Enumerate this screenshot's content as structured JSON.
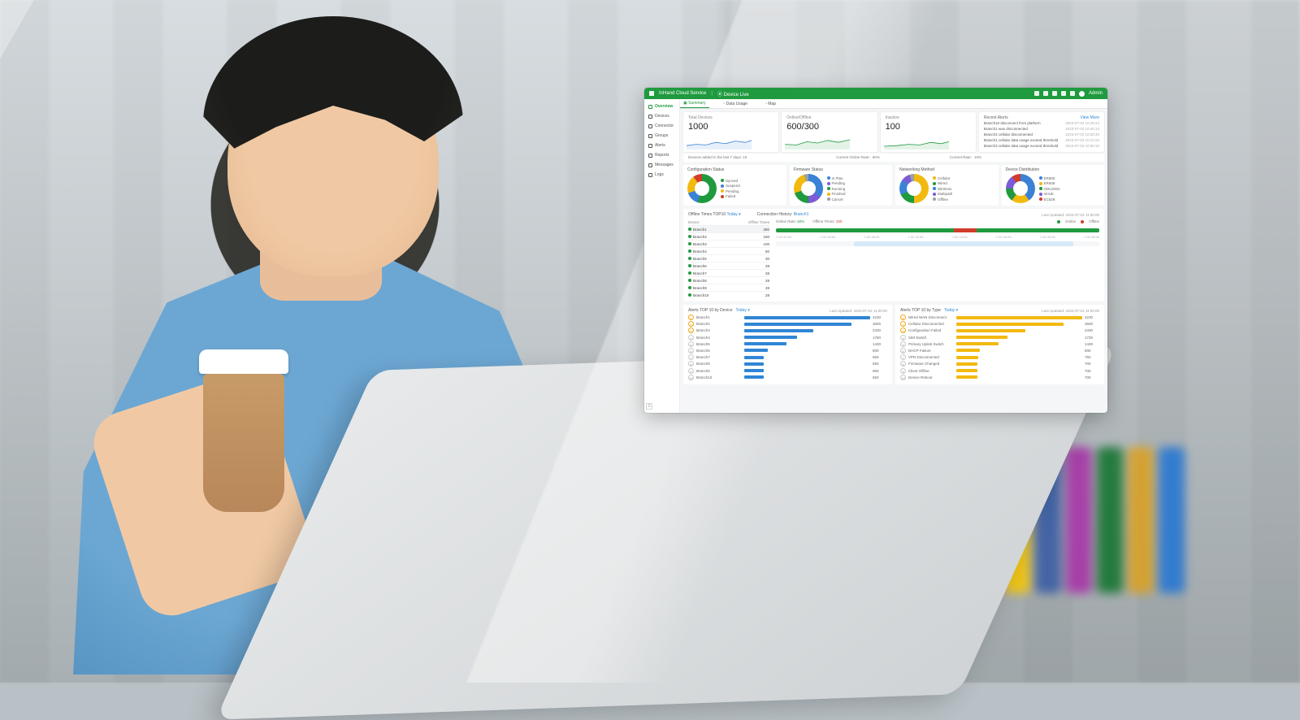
{
  "header": {
    "brand": "InHand Cloud Service",
    "product": "Device Live",
    "user": "Admin"
  },
  "sidebar": {
    "items": [
      {
        "label": "Overview",
        "active": true
      },
      {
        "label": "Devices"
      },
      {
        "label": "Connector"
      },
      {
        "label": "Groups"
      },
      {
        "label": "Alerts"
      },
      {
        "label": "Reports"
      },
      {
        "label": "Messages"
      },
      {
        "label": "Logs"
      }
    ]
  },
  "tabs": [
    {
      "label": "Summary",
      "active": true
    },
    {
      "label": "Data Usage"
    },
    {
      "label": "Map"
    }
  ],
  "stats": {
    "total": {
      "label": "Total Devices",
      "value": "1000",
      "caption": "Devices added in the last 7 days: 10"
    },
    "online": {
      "label": "Online/Offline",
      "value": "600/300",
      "caption": "Current Online Rate：60%"
    },
    "inactive": {
      "label": "Inactive",
      "value": "100",
      "caption": "Current Rate：10%"
    }
  },
  "alerts": {
    "title": "Recent Alerts",
    "view_more": "View More",
    "items": [
      {
        "text": "Branch10 disconnect from platform",
        "time": "2023-07-02 10:45:23"
      },
      {
        "text": "Branch1 wan disconnected",
        "time": "2023-07-02 10:40:14"
      },
      {
        "text": "Branch2 cellular disconnected",
        "time": "2023-07-02 10:20:40"
      },
      {
        "text": "Branch1 cellular data usage exceed threshold",
        "time": "2023-07-02 10:12:22"
      },
      {
        "text": "Branch3 cellular data usage exceed threshold",
        "time": "2023-07-02 10:00:10"
      }
    ]
  },
  "donuts": [
    {
      "title": "Configuration Status",
      "segments": [
        {
          "name": "Synced",
          "color": "#1f9a3e",
          "pct": 55
        },
        {
          "name": "Suspend",
          "color": "#3b82d6",
          "pct": 15
        },
        {
          "name": "Pending",
          "color": "#f2b90f",
          "pct": 20
        },
        {
          "name": "Failed",
          "color": "#d23c2a",
          "pct": 10
        }
      ]
    },
    {
      "title": "Firmware Status",
      "segments": [
        {
          "name": "In Plan",
          "color": "#3b82d6",
          "pct": 35
        },
        {
          "name": "Pending",
          "color": "#7c5bd6",
          "pct": 15
        },
        {
          "name": "Running",
          "color": "#1f9a3e",
          "pct": 20
        },
        {
          "name": "Finished",
          "color": "#f2b90f",
          "pct": 25
        },
        {
          "name": "Cancel",
          "color": "#9aa0a4",
          "pct": 5
        }
      ]
    },
    {
      "title": "Networking Method",
      "segments": [
        {
          "name": "Cellular",
          "color": "#f2b90f",
          "pct": 50
        },
        {
          "name": "Wired",
          "color": "#1f9a3e",
          "pct": 18
        },
        {
          "name": "Wireless",
          "color": "#3b82d6",
          "pct": 17
        },
        {
          "name": "Multipath",
          "color": "#7c5bd6",
          "pct": 10
        },
        {
          "name": "Offline",
          "color": "#9aa0a4",
          "pct": 5
        }
      ]
    },
    {
      "title": "Device Distribution",
      "segments": [
        {
          "name": "ER805",
          "color": "#3b82d6",
          "pct": 40
        },
        {
          "name": "ER605",
          "color": "#f2b90f",
          "pct": 20
        },
        {
          "name": "ODU2002",
          "color": "#1f9a3e",
          "pct": 15
        },
        {
          "name": "InHub",
          "color": "#7c5bd6",
          "pct": 15
        },
        {
          "name": "EC628",
          "color": "#d23c2a",
          "pct": 10
        }
      ]
    }
  ],
  "offline": {
    "title": "Offline Times TOP10",
    "period": "Today",
    "last_updated_label": "Last Updated",
    "last_updated": "2023-07-02 11:00:00",
    "cols": {
      "device": "Device",
      "times": "Offline Times"
    },
    "rows": [
      {
        "device": "Branch1",
        "times": 280,
        "active": true
      },
      {
        "device": "Branch2",
        "times": 150
      },
      {
        "device": "Branch3",
        "times": 100
      },
      {
        "device": "Branch4",
        "times": 50
      },
      {
        "device": "Branch5",
        "times": 30
      },
      {
        "device": "Branch6",
        "times": 28
      },
      {
        "device": "Branch7",
        "times": 28
      },
      {
        "device": "Branch8",
        "times": 28
      },
      {
        "device": "Branch9",
        "times": 28
      },
      {
        "device": "Branch10",
        "times": 28
      }
    ],
    "connection": {
      "title": "Connection History",
      "subject": "Branch1",
      "online_rate_label": "Online Rate",
      "online_rate": "60%",
      "offline_times_label": "Offline Times",
      "offline_times": "200",
      "legend": {
        "online": "Online",
        "offline": "Offline"
      },
      "ticks": [
        "7-02 00:00",
        "7-02 04:00",
        "7-02 08:00",
        "7-02 12:00",
        "7-02 16:00",
        "7-02 18:00",
        "7-02 20:00",
        "7-02 20:00"
      ]
    }
  },
  "barcharts": {
    "byDevice": {
      "title": "Alerts TOP 10 by Device",
      "period": "Today",
      "last_updated": "2023-07-02 11:00:00",
      "color": "#2f86d6",
      "rows": [
        {
          "name": "Branch1",
          "value": 4230
        },
        {
          "name": "Branch2",
          "value": 3600
        },
        {
          "name": "Branch3",
          "value": 2330
        },
        {
          "name": "Branch4",
          "value": 1780
        },
        {
          "name": "Branch5",
          "value": 1430
        },
        {
          "name": "Branch6",
          "value": 800
        },
        {
          "name": "Branch7",
          "value": 650
        },
        {
          "name": "Branch8",
          "value": 650
        },
        {
          "name": "Branch9",
          "value": 650
        },
        {
          "name": "Branch10",
          "value": 650
        }
      ]
    },
    "byType": {
      "title": "Alerts TOP 10 by Type",
      "period": "Today",
      "last_updated": "2023-07-02 11:00:00",
      "color": "#f2b90f",
      "rows": [
        {
          "name": "Wired WAN Disconnect",
          "value": 4230
        },
        {
          "name": "Cellular Disconnected",
          "value": 3600
        },
        {
          "name": "Configuration Failed",
          "value": 2330
        },
        {
          "name": "SIM Switch",
          "value": 1730
        },
        {
          "name": "Primary Uplink Switch",
          "value": 1430
        },
        {
          "name": "DHCP Failure",
          "value": 800
        },
        {
          "name": "VPN Disconnected",
          "value": 750
        },
        {
          "name": "Firmware Changed",
          "value": 700
        },
        {
          "name": "Client Offline",
          "value": 700
        },
        {
          "name": "Device Reboot",
          "value": 700
        }
      ]
    }
  },
  "chart_data": [
    {
      "type": "donut",
      "title": "Configuration Status",
      "series": [
        {
          "name": "Synced",
          "value": 55
        },
        {
          "name": "Suspend",
          "value": 15
        },
        {
          "name": "Pending",
          "value": 20
        },
        {
          "name": "Failed",
          "value": 10
        }
      ]
    },
    {
      "type": "donut",
      "title": "Firmware Status",
      "series": [
        {
          "name": "In Plan",
          "value": 35
        },
        {
          "name": "Pending",
          "value": 15
        },
        {
          "name": "Running",
          "value": 20
        },
        {
          "name": "Finished",
          "value": 25
        },
        {
          "name": "Cancel",
          "value": 5
        }
      ]
    },
    {
      "type": "donut",
      "title": "Networking Method",
      "series": [
        {
          "name": "Cellular",
          "value": 50
        },
        {
          "name": "Wired",
          "value": 18
        },
        {
          "name": "Wireless",
          "value": 17
        },
        {
          "name": "Multipath",
          "value": 10
        },
        {
          "name": "Offline",
          "value": 5
        }
      ]
    },
    {
      "type": "donut",
      "title": "Device Distribution",
      "series": [
        {
          "name": "ER805",
          "value": 40
        },
        {
          "name": "ER605",
          "value": 20
        },
        {
          "name": "ODU2002",
          "value": 15
        },
        {
          "name": "InHub",
          "value": 15
        },
        {
          "name": "EC628",
          "value": 10
        }
      ]
    },
    {
      "type": "bar",
      "title": "Alerts TOP 10 by Device",
      "categories": [
        "Branch1",
        "Branch2",
        "Branch3",
        "Branch4",
        "Branch5",
        "Branch6",
        "Branch7",
        "Branch8",
        "Branch9",
        "Branch10"
      ],
      "values": [
        4230,
        3600,
        2330,
        1780,
        1430,
        800,
        650,
        650,
        650,
        650
      ],
      "ylim": [
        0,
        4500
      ]
    },
    {
      "type": "bar",
      "title": "Alerts TOP 10 by Type",
      "categories": [
        "Wired WAN Disconnect",
        "Cellular Disconnected",
        "Configuration Failed",
        "SIM Switch",
        "Primary Uplink Switch",
        "DHCP Failure",
        "VPN Disconnected",
        "Firmware Changed",
        "Client Offline",
        "Device Reboot"
      ],
      "values": [
        4230,
        3600,
        2330,
        1730,
        1430,
        800,
        750,
        700,
        700,
        700
      ],
      "ylim": [
        0,
        4500
      ]
    },
    {
      "type": "table",
      "title": "Offline Times TOP10",
      "categories": [
        "Branch1",
        "Branch2",
        "Branch3",
        "Branch4",
        "Branch5",
        "Branch6",
        "Branch7",
        "Branch8",
        "Branch9",
        "Branch10"
      ],
      "values": [
        280,
        150,
        100,
        50,
        30,
        28,
        28,
        28,
        28,
        28
      ]
    }
  ]
}
